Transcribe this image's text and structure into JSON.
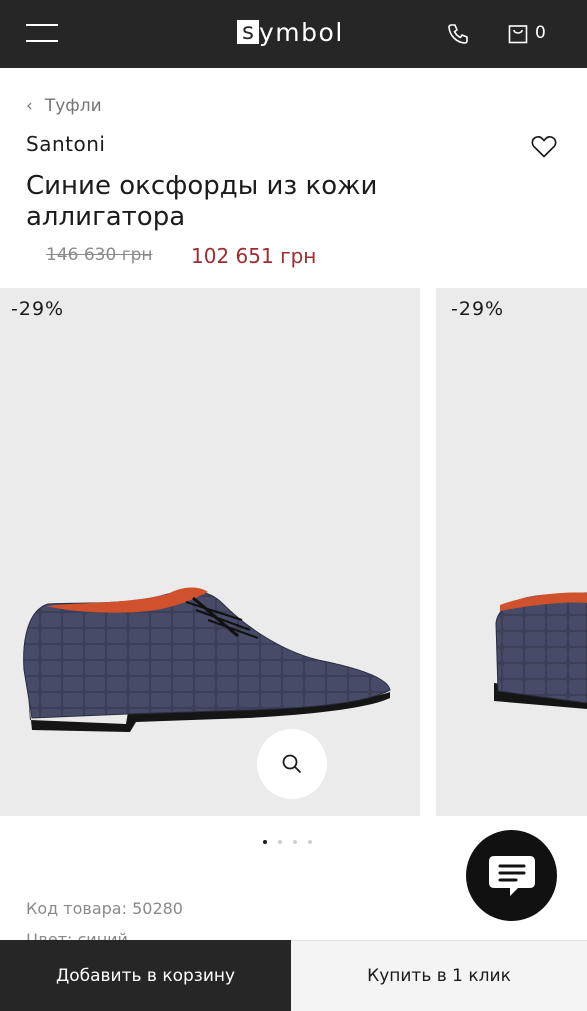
{
  "header": {
    "logo_box": "s",
    "logo_text": "ymbol",
    "cart_count": "0"
  },
  "breadcrumb": {
    "label": "Туфли"
  },
  "product": {
    "brand": "Santoni",
    "title": "Синие оксфорды из кожи аллигатора",
    "old_price": "146 630 грн",
    "new_price": "102 651 грн",
    "sku": "Код товара: 50280",
    "color_partial": "Цвет: синий"
  },
  "gallery": {
    "badge_1": "-29%",
    "badge_2": "-29%",
    "active_slide": 1,
    "slide_count": 4
  },
  "actions": {
    "add_to_cart": "Добавить в корзину",
    "buy_one_click": "Купить в 1 клик"
  },
  "colors": {
    "header_bg": "#262626",
    "price_red": "#9e2b30",
    "gallery_bg": "#ebebeb"
  }
}
